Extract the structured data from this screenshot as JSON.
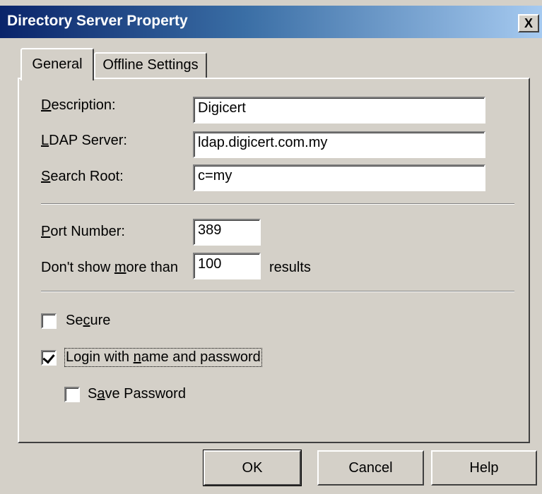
{
  "window": {
    "title": "Directory Server Property",
    "close_label": "X"
  },
  "tabs": [
    {
      "label": "General",
      "active": true
    },
    {
      "label": "Offline Settings",
      "active": false
    }
  ],
  "general": {
    "description_label_pre": "",
    "description_label_ul": "D",
    "description_label_post": "escription:",
    "description_value": "Digicert",
    "ldap_label_ul": "L",
    "ldap_label_post": "DAP Server:",
    "ldap_value": "ldap.digicert.com.my",
    "search_label_ul": "S",
    "search_label_post": "earch Root:",
    "search_value": "c=my",
    "port_label_ul": "P",
    "port_label_post": "ort Number:",
    "port_value": "389",
    "max_label_pre": "Don't show ",
    "max_label_ul": "m",
    "max_label_post": "ore than",
    "max_value": "100",
    "max_suffix": "results",
    "secure_pre": "Se",
    "secure_ul": "c",
    "secure_post": "ure",
    "secure_checked": false,
    "login_pre": "Login with ",
    "login_ul": "n",
    "login_post": "ame and password",
    "login_checked": true,
    "savepw_pre": "S",
    "savepw_ul": "a",
    "savepw_post": "ve Password",
    "savepw_checked": false
  },
  "buttons": {
    "ok": "OK",
    "cancel": "Cancel",
    "help": "Help"
  }
}
